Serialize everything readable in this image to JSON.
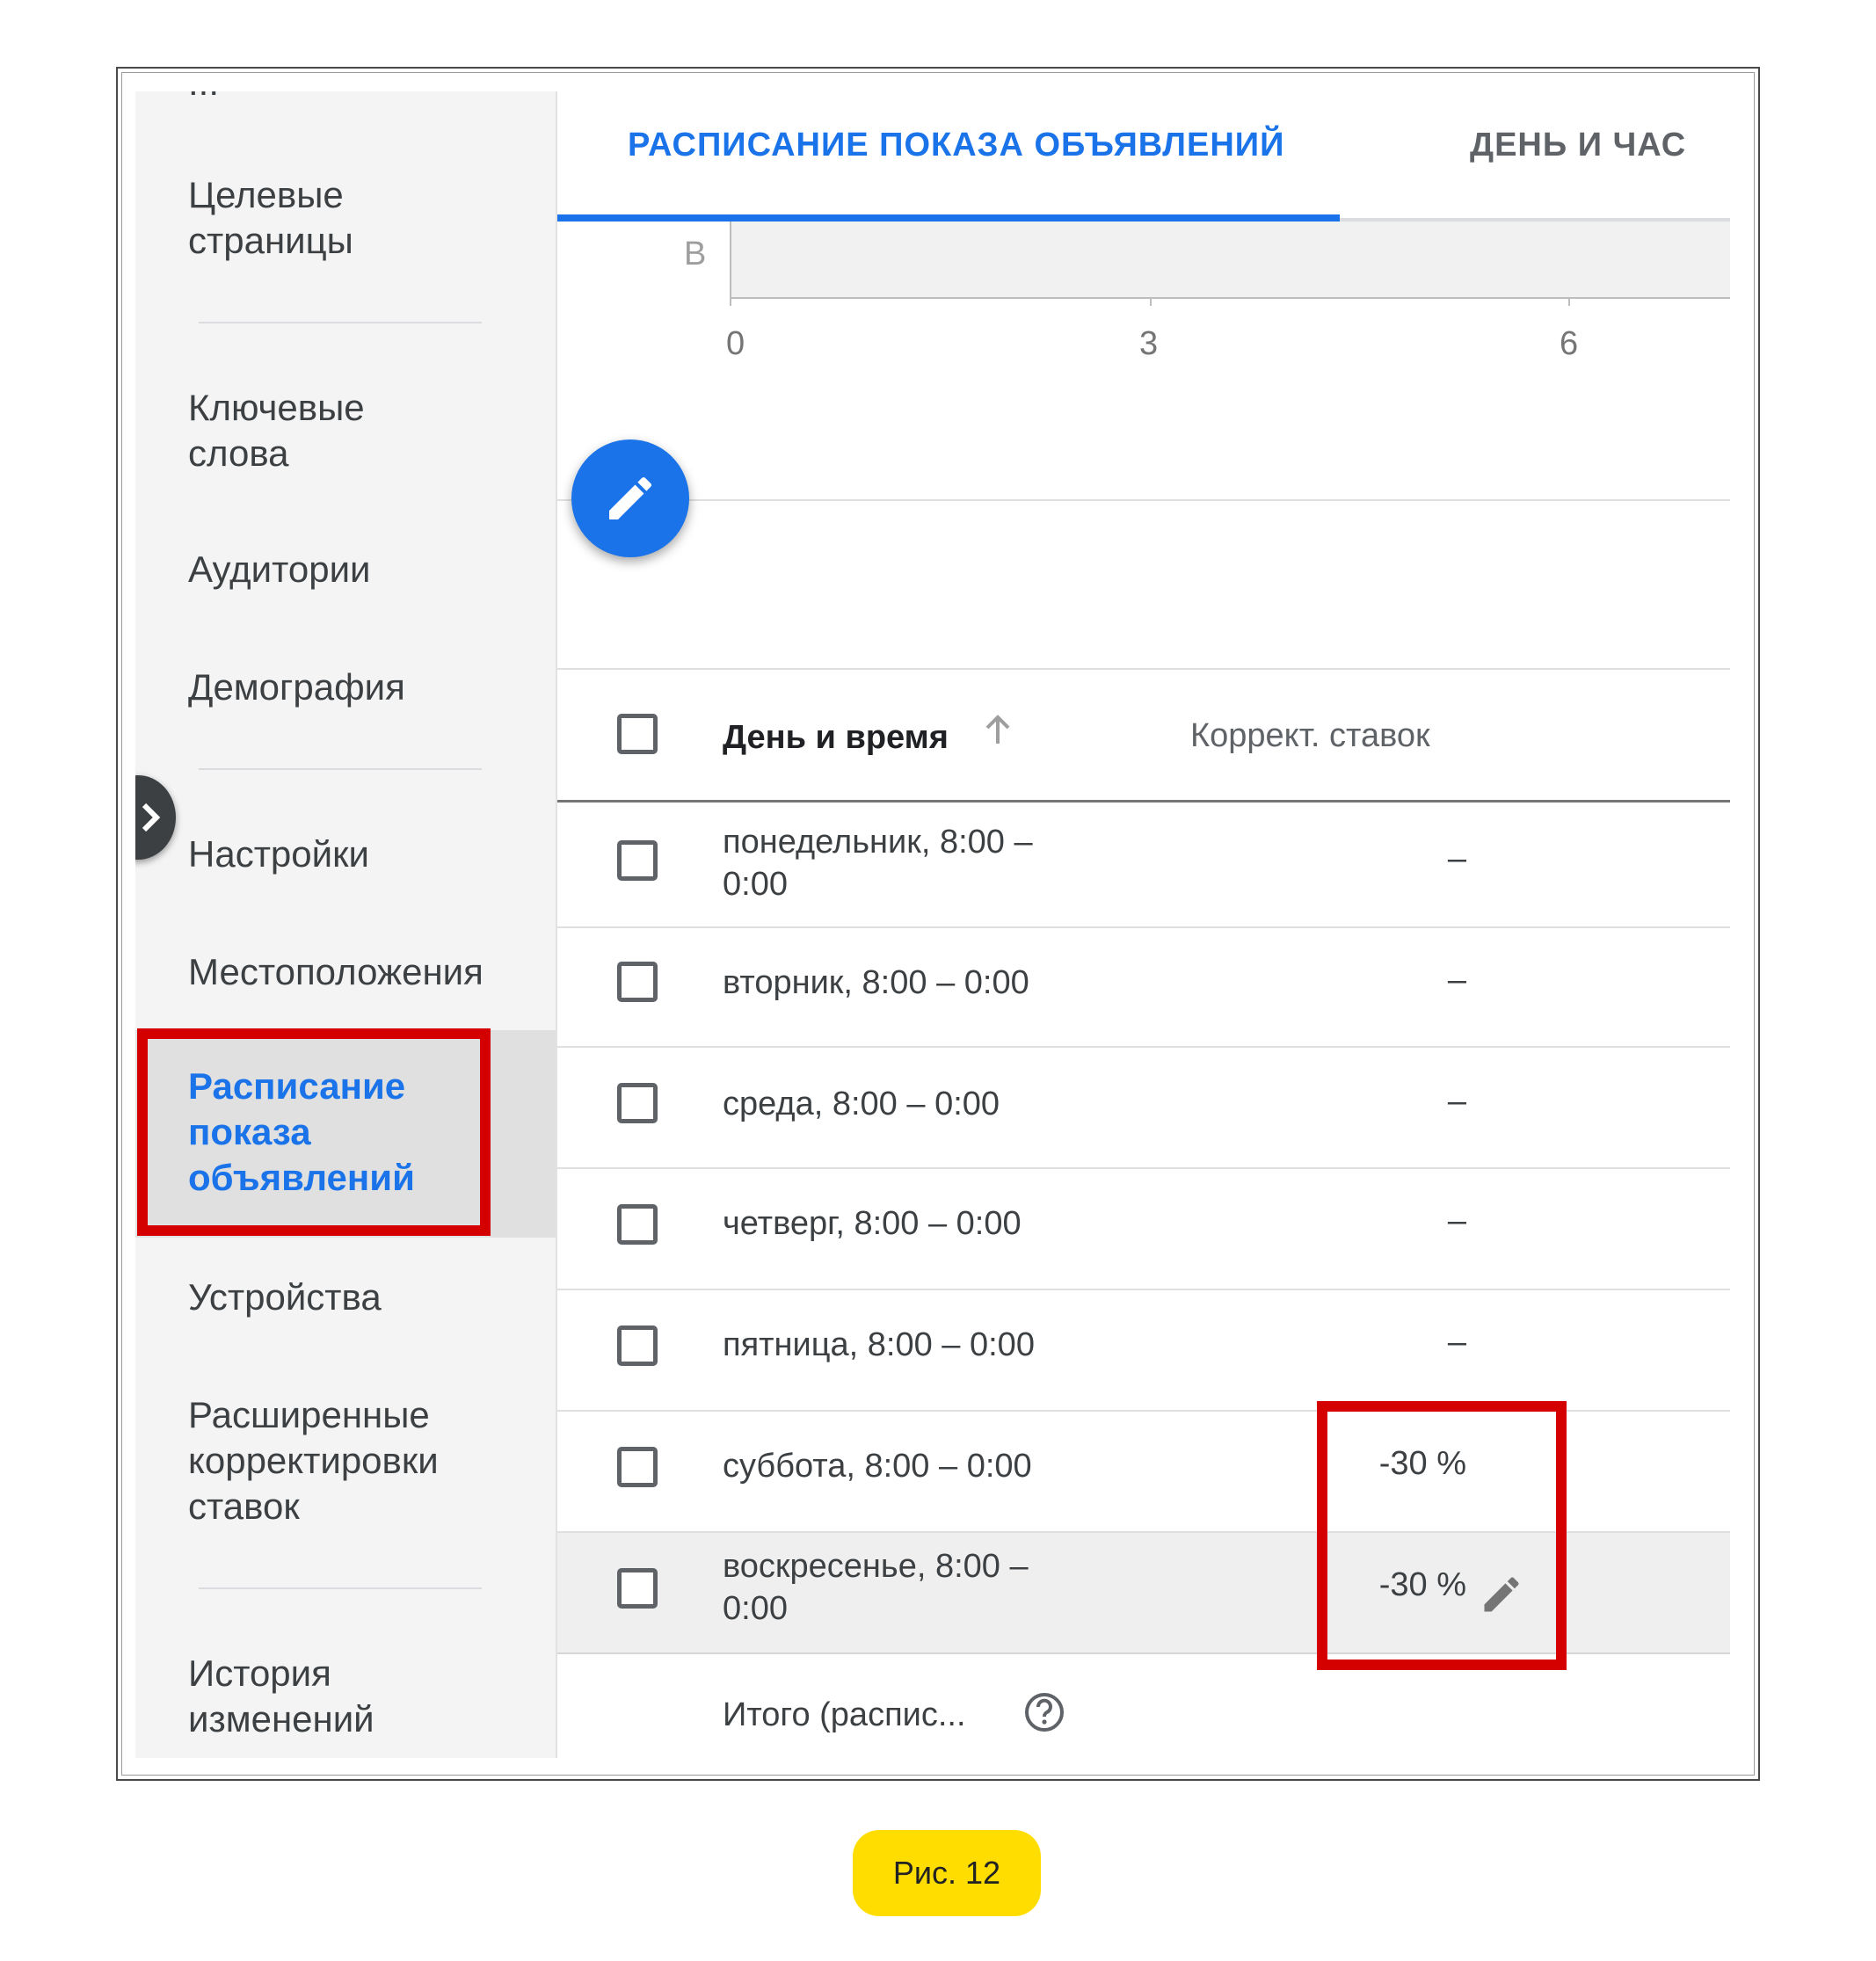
{
  "sidebar": {
    "cut_off_text": "...",
    "items": [
      {
        "label": "Целевые\nстраницы"
      },
      {
        "label": "Ключевые\nслова"
      },
      {
        "label": "Аудитории"
      },
      {
        "label": "Демография"
      },
      {
        "label": "Настройки"
      },
      {
        "label": "Местоположения"
      },
      {
        "label": "Расписание\nпоказа\nобъявлений"
      },
      {
        "label": "Устройства"
      },
      {
        "label": "Расширенные\nкорректировки\nставок"
      },
      {
        "label": "История\nизменений"
      }
    ],
    "active_color": "#1a73e8"
  },
  "tabs": [
    {
      "label": "РАСПИСАНИЕ ПОКАЗА ОБЪЯВЛЕНИЙ",
      "active": true
    },
    {
      "label": "ДЕНЬ И ЧАС",
      "active": false
    }
  ],
  "mini_chart": {
    "row_label": "В",
    "ticks": [
      "0",
      "3",
      "6"
    ]
  },
  "table": {
    "headers": {
      "day_time": "День и время",
      "bid_adjustment": "Коррект. ставок"
    },
    "rows": [
      {
        "day": "понедельник, 8:00 –\n0:00",
        "bid": "–"
      },
      {
        "day": "вторник, 8:00 – 0:00",
        "bid": "–"
      },
      {
        "day": "среда, 8:00 – 0:00",
        "bid": "–"
      },
      {
        "day": "четверг, 8:00 – 0:00",
        "bid": "–"
      },
      {
        "day": "пятница, 8:00 – 0:00",
        "bid": "–"
      },
      {
        "day": "суббота, 8:00 – 0:00",
        "bid": "-30 %"
      },
      {
        "day": "воскресенье, 8:00 –\n0:00",
        "bid": "-30 %"
      }
    ],
    "total_label": "Итого (распис..."
  },
  "icons": [
    "pencil-icon",
    "chevron-right-icon",
    "arrow-up-icon",
    "help-circle-icon"
  ],
  "highlight_color": "#d40000",
  "caption": "Рис. 12"
}
